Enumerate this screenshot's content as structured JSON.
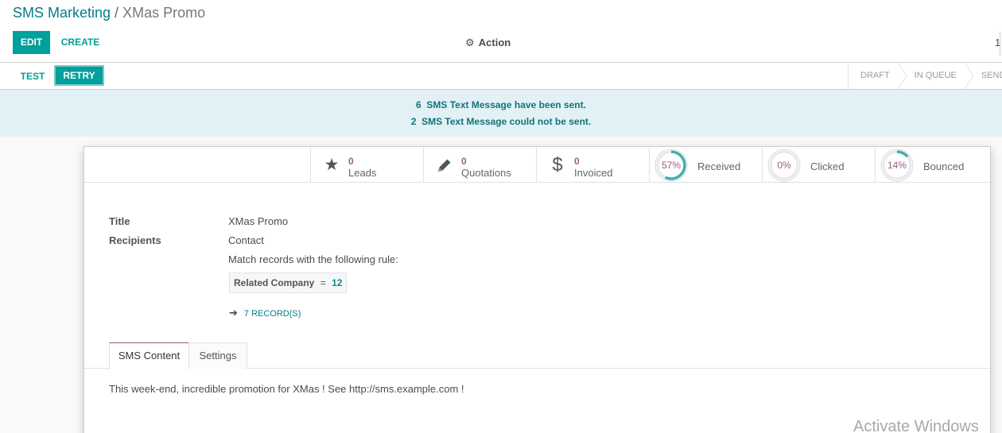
{
  "breadcrumb": {
    "parent": "SMS Marketing",
    "separator": "/",
    "current": "XMas Promo"
  },
  "toolbar": {
    "edit_label": "EDIT",
    "create_label": "CREATE",
    "action_label": "Action",
    "pager_value": "1"
  },
  "statusbar": {
    "test_label": "TEST",
    "retry_label": "RETRY",
    "stages": [
      "DRAFT",
      "IN QUEUE",
      "SENDING"
    ]
  },
  "alert": {
    "sent_count": "6",
    "sent_text": "SMS Text Message have been sent.",
    "failed_count": "2",
    "failed_text": "SMS Text Message could not be sent."
  },
  "stats": {
    "leads": {
      "value": "0",
      "label": "Leads",
      "icon": "star-icon"
    },
    "quotations": {
      "value": "0",
      "label": "Quotations",
      "icon": "pencil-icon"
    },
    "invoiced": {
      "value": "0",
      "label": "Invoiced",
      "icon": "dollar-icon"
    },
    "received": {
      "percent_text": "57%",
      "percent": 57,
      "label": "Received"
    },
    "clicked": {
      "percent_text": "0%",
      "percent": 0,
      "label": "Clicked"
    },
    "bounced": {
      "percent_text": "14%",
      "percent": 14,
      "label": "Bounced"
    }
  },
  "form": {
    "title_label": "Title",
    "title_value": "XMas Promo",
    "recipients_label": "Recipients",
    "recipients_value": "Contact",
    "rule_text": "Match records with the following rule:",
    "domain_field": "Related Company",
    "domain_operator": "=",
    "domain_value": "12",
    "records_link": "7 RECORD(S)"
  },
  "tabs": {
    "sms_content": "SMS Content",
    "settings": "Settings"
  },
  "sms_body": "This week-end, incredible promotion for XMas ! See http://sms.example.com !",
  "watermark": "Activate Windows",
  "colors": {
    "primary": "#00a09d",
    "link": "#017e84",
    "stat_value": "#9a5b86",
    "alert_bg": "#e2f1f5",
    "gauge_fill": "#3fb0ad"
  }
}
